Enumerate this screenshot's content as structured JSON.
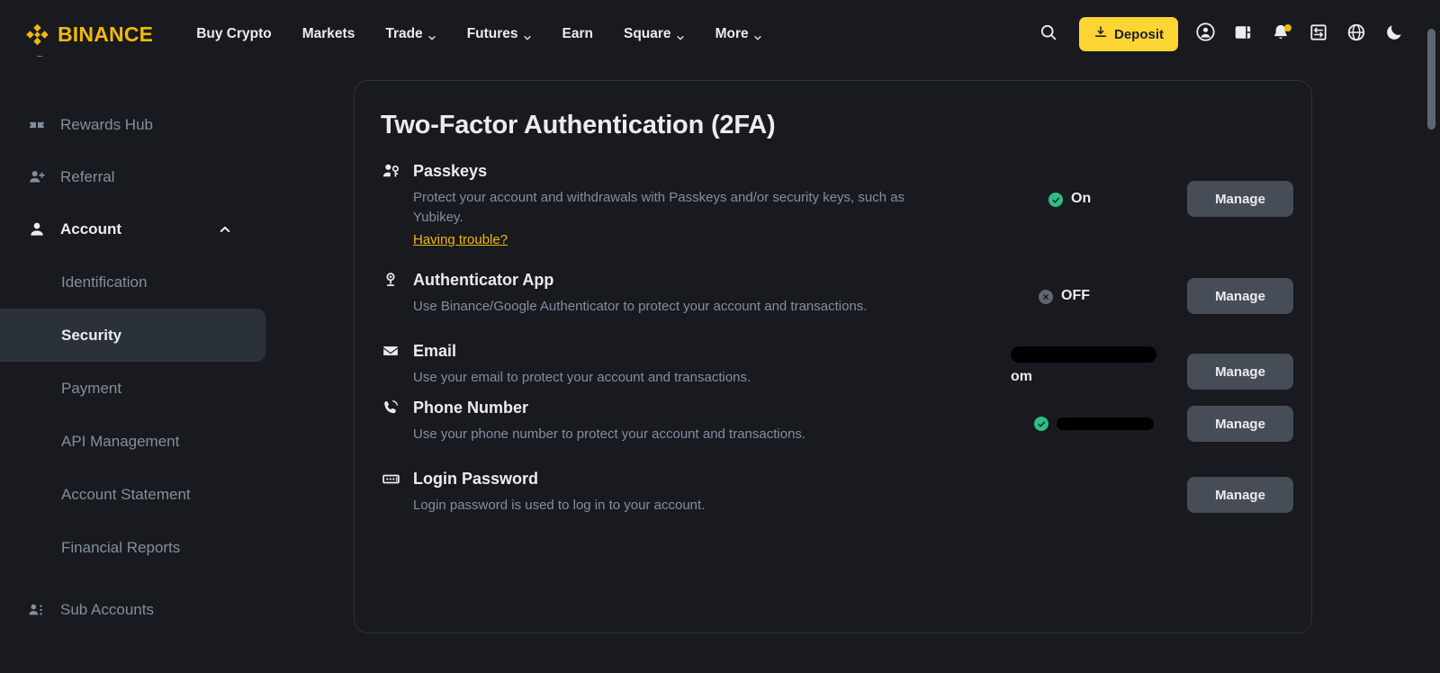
{
  "brand": {
    "name": "BINANCE",
    "color": "#F0B90B"
  },
  "topnav": {
    "links": [
      {
        "label": "Buy Crypto",
        "caret": false
      },
      {
        "label": "Markets",
        "caret": false
      },
      {
        "label": "Trade",
        "caret": true
      },
      {
        "label": "Futures",
        "caret": true
      },
      {
        "label": "Earn",
        "caret": false
      },
      {
        "label": "Square",
        "caret": true
      },
      {
        "label": "More",
        "caret": true
      }
    ],
    "search_icon": "search-icon",
    "deposit_label": "Deposit",
    "deposit_icon": "download-icon",
    "right_icons": [
      "profile-icon",
      "wallet-icon",
      "notification-bell-icon",
      "orders-icon",
      "language-globe-icon",
      "dark-mode-moon-icon"
    ]
  },
  "sidebar": {
    "items": [
      {
        "label": "Rewards Hub",
        "icon": "ticket-icon",
        "type": "item"
      },
      {
        "label": "Referral",
        "icon": "person-add-icon",
        "type": "item"
      },
      {
        "label": "Account",
        "icon": "person-icon",
        "type": "parent",
        "expanded": true,
        "chevron": "chevron-up-icon"
      },
      {
        "label": "Identification",
        "type": "sub",
        "active": false
      },
      {
        "label": "Security",
        "type": "sub",
        "active": true
      },
      {
        "label": "Payment",
        "type": "sub",
        "active": false
      },
      {
        "label": "API Management",
        "type": "sub",
        "active": false
      },
      {
        "label": "Account Statement",
        "type": "sub",
        "active": false
      },
      {
        "label": "Financial Reports",
        "type": "sub",
        "active": false
      },
      {
        "label": "Sub Accounts",
        "icon": "people-list-icon",
        "type": "item"
      }
    ]
  },
  "main": {
    "title": "Two-Factor Authentication (2FA)",
    "manage_label": "Manage",
    "rows": [
      {
        "title": "Passkeys",
        "icon": "passkey-person-key-icon",
        "desc": "Protect your account and withdrawals with Passkeys and/or security keys, such as Yubikey.",
        "link": "Having trouble?",
        "status_kind": "on",
        "status_text": "On",
        "status_icon": "check-circle-icon",
        "action": "Manage"
      },
      {
        "title": "Authenticator App",
        "icon": "authenticator-icon",
        "desc": "Use Binance/Google Authenticator to protect your account and transactions.",
        "link": null,
        "status_kind": "off",
        "status_text": "OFF",
        "status_icon": "x-circle-icon",
        "action": "Manage"
      },
      {
        "title": "Email",
        "icon": "envelope-icon",
        "desc": "Use your email to protect your account and transactions.",
        "link": null,
        "status_kind": "redacted-email",
        "status_text": "om",
        "status_icon": null,
        "action": "Manage"
      },
      {
        "title": "Phone Number",
        "icon": "phone-icon",
        "desc": "Use your phone number to protect your account and transactions.",
        "link": null,
        "status_kind": "redacted-phone",
        "status_text": "",
        "status_icon": "check-circle-icon",
        "action": "Manage"
      },
      {
        "title": "Login Password",
        "icon": "password-field-icon",
        "desc": "Login password is used to log in to your account.",
        "link": null,
        "status_kind": "none",
        "status_text": "",
        "status_icon": null,
        "action": "Manage"
      }
    ]
  },
  "colors": {
    "background": "#181A20",
    "accent": "#F0B90B",
    "deposit": "#FCD535",
    "text_primary": "#EAECEF",
    "text_secondary": "#848E9C",
    "success": "#2EBD85",
    "muted": "#5E6673",
    "button": "#474D57",
    "card_border": "#2B3139"
  }
}
